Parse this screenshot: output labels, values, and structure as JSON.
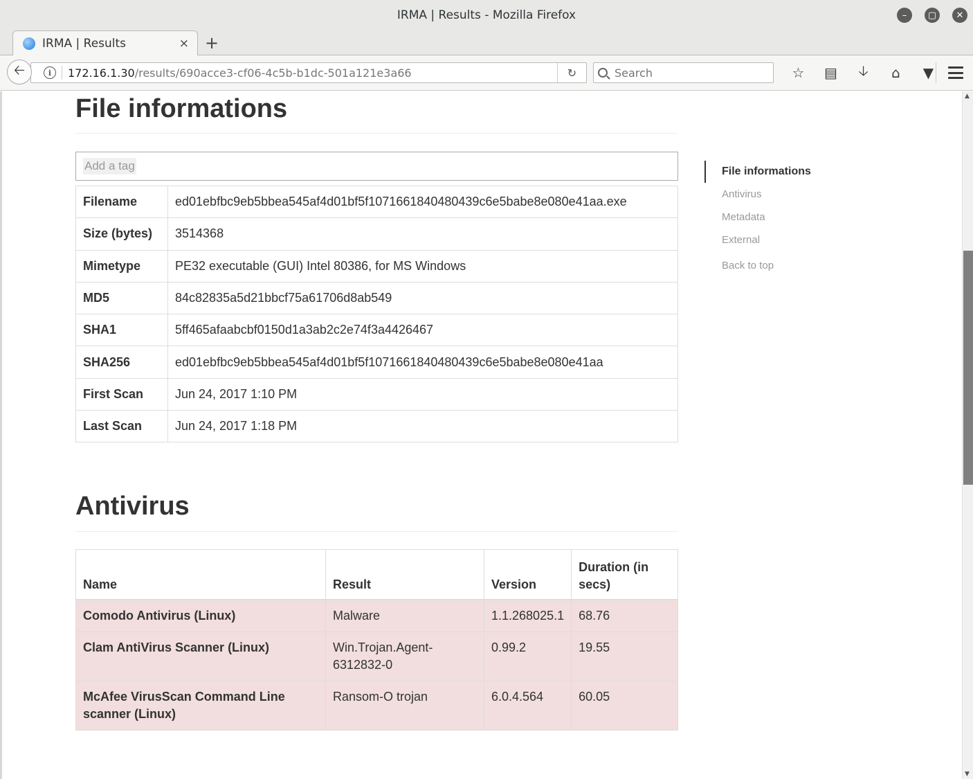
{
  "window": {
    "title": "IRMA | Results - Mozilla Firefox"
  },
  "tab": {
    "label": "IRMA | Results",
    "close": "×",
    "new_tab": "+"
  },
  "nav": {
    "url_host": "172.16.1.30",
    "url_path": "/results/690acce3-cf06-4c5b-b1dc-501a121e3a66",
    "search_placeholder": "Search"
  },
  "file_info": {
    "heading": "File informations",
    "tag_placeholder": "Add a tag",
    "rows": [
      {
        "label": "Filename",
        "value": "ed01ebfbc9eb5bbea545af4d01bf5f1071661840480439c6e5babe8e080e41aa.exe"
      },
      {
        "label": "Size (bytes)",
        "value": "3514368"
      },
      {
        "label": "Mimetype",
        "value": "PE32 executable (GUI) Intel 80386, for MS Windows"
      },
      {
        "label": "MD5",
        "value": "84c82835a5d21bbcf75a61706d8ab549"
      },
      {
        "label": "SHA1",
        "value": "5ff465afaabcbf0150d1a3ab2c2e74f3a4426467"
      },
      {
        "label": "SHA256",
        "value": "ed01ebfbc9eb5bbea545af4d01bf5f1071661840480439c6e5babe8e080e41aa"
      },
      {
        "label": "First Scan",
        "value": "Jun 24, 2017 1:10 PM"
      },
      {
        "label": "Last Scan",
        "value": "Jun 24, 2017 1:18 PM"
      }
    ]
  },
  "antivirus": {
    "heading": "Antivirus",
    "columns": [
      "Name",
      "Result",
      "Version",
      "Duration (in secs)"
    ],
    "rows": [
      {
        "name": "Comodo Antivirus (Linux)",
        "result": "Malware",
        "version": "1.1.268025.1",
        "duration": "68.76"
      },
      {
        "name": "Clam AntiVirus Scanner (Linux)",
        "result": "Win.Trojan.Agent-6312832-0",
        "version": "0.99.2",
        "duration": "19.55"
      },
      {
        "name": "McAfee VirusScan Command Line scanner (Linux)",
        "result": "Ransom-O trojan",
        "version": "6.0.4.564",
        "duration": "60.05"
      }
    ],
    "infected_color": "#f2dede"
  },
  "sidenav": {
    "active": "File informations",
    "items": [
      "Antivirus",
      "Metadata",
      "External"
    ],
    "back_to_top": "Back to top"
  }
}
